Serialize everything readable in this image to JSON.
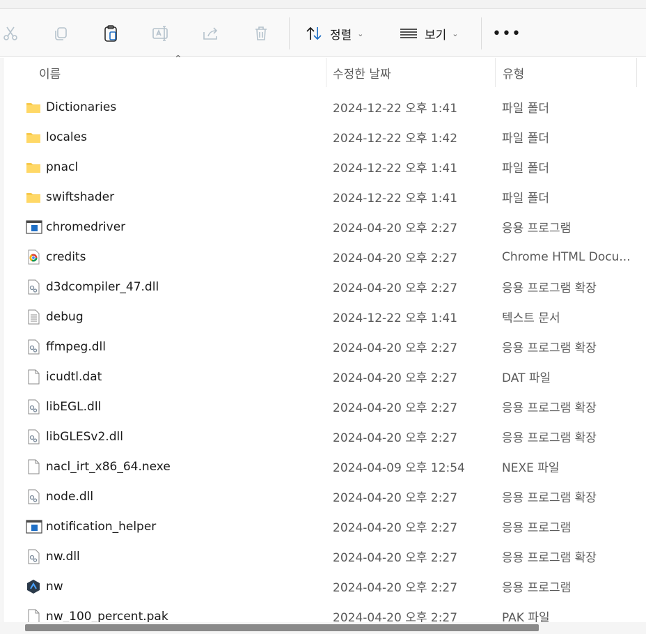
{
  "toolbar": {
    "sort_label": "정렬",
    "view_label": "보기",
    "more_label": "•••"
  },
  "columns": {
    "name": "이름",
    "modified": "수정한 날짜",
    "type": "유형"
  },
  "files": [
    {
      "name": "Dictionaries",
      "date": "2024-12-22 오후 1:41",
      "type": "파일 폴더",
      "icon": "folder-icon"
    },
    {
      "name": "locales",
      "date": "2024-12-22 오후 1:42",
      "type": "파일 폴더",
      "icon": "folder-icon"
    },
    {
      "name": "pnacl",
      "date": "2024-12-22 오후 1:41",
      "type": "파일 폴더",
      "icon": "folder-icon"
    },
    {
      "name": "swiftshader",
      "date": "2024-12-22 오후 1:41",
      "type": "파일 폴더",
      "icon": "folder-icon"
    },
    {
      "name": "chromedriver",
      "date": "2024-04-20 오후 2:27",
      "type": "응용 프로그램",
      "icon": "application-icon"
    },
    {
      "name": "credits",
      "date": "2024-04-20 오후 2:27",
      "type": "Chrome HTML Docu...",
      "icon": "chrome-icon"
    },
    {
      "name": "d3dcompiler_47.dll",
      "date": "2024-04-20 오후 2:27",
      "type": "응용 프로그램 확장",
      "icon": "dll-icon"
    },
    {
      "name": "debug",
      "date": "2024-12-22 오후 1:41",
      "type": "텍스트 문서",
      "icon": "text-file-icon"
    },
    {
      "name": "ffmpeg.dll",
      "date": "2024-04-20 오후 2:27",
      "type": "응용 프로그램 확장",
      "icon": "dll-icon"
    },
    {
      "name": "icudtl.dat",
      "date": "2024-04-20 오후 2:27",
      "type": "DAT 파일",
      "icon": "blank-file-icon"
    },
    {
      "name": "libEGL.dll",
      "date": "2024-04-20 오후 2:27",
      "type": "응용 프로그램 확장",
      "icon": "dll-icon"
    },
    {
      "name": "libGLESv2.dll",
      "date": "2024-04-20 오후 2:27",
      "type": "응용 프로그램 확장",
      "icon": "dll-icon"
    },
    {
      "name": "nacl_irt_x86_64.nexe",
      "date": "2024-04-09 오후 12:54",
      "type": "NEXE 파일",
      "icon": "blank-file-icon"
    },
    {
      "name": "node.dll",
      "date": "2024-04-20 오후 2:27",
      "type": "응용 프로그램 확장",
      "icon": "dll-icon"
    },
    {
      "name": "notification_helper",
      "date": "2024-04-20 오후 2:27",
      "type": "응용 프로그램",
      "icon": "application-icon"
    },
    {
      "name": "nw.dll",
      "date": "2024-04-20 오후 2:27",
      "type": "응용 프로그램 확장",
      "icon": "dll-icon"
    },
    {
      "name": "nw",
      "date": "2024-04-20 오후 2:27",
      "type": "응용 프로그램",
      "icon": "nw-app-icon"
    },
    {
      "name": "nw_100_percent.pak",
      "date": "2024-04-20 오후 2:27",
      "type": "PAK 파일",
      "icon": "blank-file-icon"
    }
  ],
  "colors": {
    "folder": "#F8C94A",
    "app_blue": "#1F6FC5",
    "muted_text": "#5a5a5a"
  }
}
